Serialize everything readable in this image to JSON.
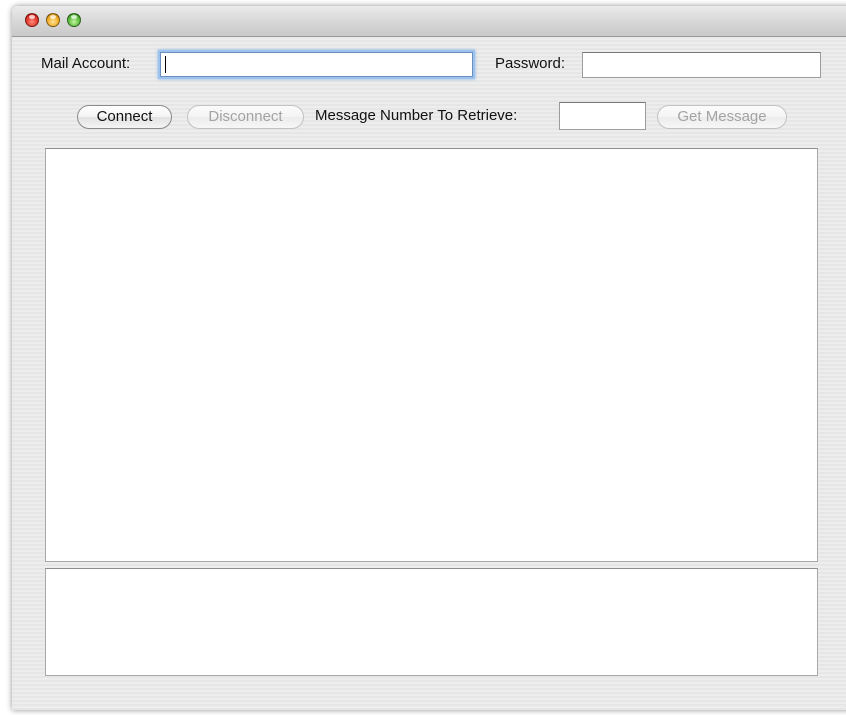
{
  "window": {
    "buttons": [
      "close",
      "minimize",
      "zoom"
    ]
  },
  "account": {
    "label": "Mail Account:",
    "value": "",
    "password_label": "Password:",
    "password_value": ""
  },
  "toolbar": {
    "connect_label": "Connect",
    "disconnect_label": "Disconnect",
    "message_number_label": "Message Number To Retrieve:",
    "message_number_value": "",
    "get_message_label": "Get Message"
  },
  "content": {
    "message_text": "",
    "status_text": ""
  }
}
